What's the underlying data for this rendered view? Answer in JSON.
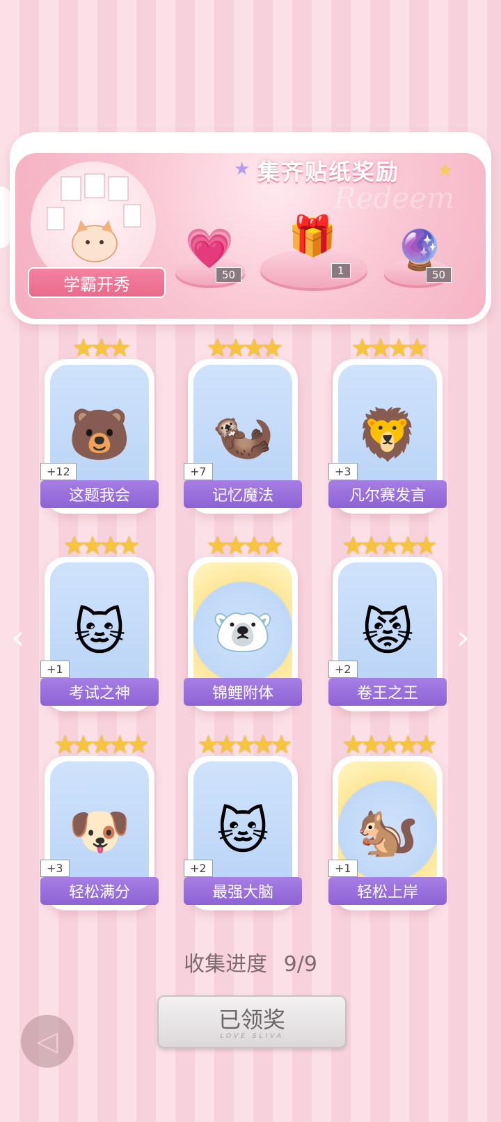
{
  "banner": {
    "title": "集齐贴纸奖励",
    "watermark": "Redeem",
    "feature": {
      "label": "学霸开秀",
      "icon": "cat-with-papers-icon"
    },
    "rewards": [
      {
        "icon": "pink-heart-gem-icon",
        "count": "50"
      },
      {
        "icon": "gift-box-icon",
        "count": "1"
      },
      {
        "icon": "lightning-orb-icon",
        "count": "50"
      }
    ]
  },
  "cards": [
    {
      "name": "这题我会",
      "plus": "+12",
      "stars": "★★★",
      "icon": "bear-at-desk-icon",
      "emoji": "🐻"
    },
    {
      "name": "记忆魔法",
      "plus": "+7",
      "stars": "★★★★",
      "icon": "otter-wizard-icon",
      "emoji": "🦦"
    },
    {
      "name": "凡尔赛发言",
      "plus": "+3",
      "stars": "★★★★",
      "icon": "lion-microphone-icon",
      "emoji": "🦁"
    },
    {
      "name": "考试之神",
      "plus": "+1",
      "stars": "★★★★",
      "icon": "angel-cat-icon",
      "emoji": "🐱"
    },
    {
      "name": "锦鲤附体",
      "plus": "",
      "stars": "★★★★",
      "icon": "bear-koi-icon",
      "emoji": "🐻‍❄️"
    },
    {
      "name": "卷王之王",
      "plus": "+2",
      "stars": "★★★★★",
      "icon": "cat-headband-icon",
      "emoji": "😾"
    },
    {
      "name": "轻松满分",
      "plus": "+3",
      "stars": "★★★★★",
      "icon": "puppy-full-marks-icon",
      "emoji": "🐶"
    },
    {
      "name": "最强大脑",
      "plus": "+2",
      "stars": "★★★★★",
      "icon": "cat-with-papers-icon",
      "emoji": "🐱"
    },
    {
      "name": "轻松上岸",
      "plus": "+1",
      "stars": "★★★★★",
      "icon": "squirrel-graduate-icon",
      "emoji": "🐿️"
    }
  ],
  "progress": {
    "label": "收集进度",
    "value": "9/9"
  },
  "claim_button": {
    "label": "已领奖",
    "sub": "LOVE SLIVA"
  }
}
